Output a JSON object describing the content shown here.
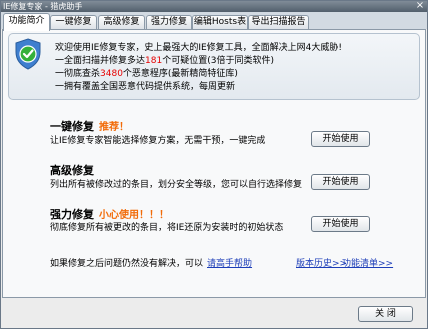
{
  "window": {
    "title": "IE修复专家 - 猎虎助手",
    "close_icon": "close-icon",
    "close_glyph": "×"
  },
  "tabs": [
    {
      "label": "功能简介",
      "selected": true
    },
    {
      "label": "一键修复"
    },
    {
      "label": "高级修复"
    },
    {
      "label": "强力修复"
    },
    {
      "label": "编辑Hosts表"
    },
    {
      "label": "导出扫描报告"
    }
  ],
  "intro": {
    "icon": "shield-check-icon",
    "welcome": "欢迎使用IE修复专家，史上最强大的IE修复工具，全面解决上网4大威胁!",
    "scan": {
      "before": "一全面扫描并修复多达",
      "count": "181",
      "after": "个可疑位置(3倍于同类软件)"
    },
    "kill": {
      "before": "一彻底查杀",
      "count": "3480",
      "after": "个恶意程序(最新精简特征库)"
    },
    "update": "一拥有覆盖全国恶意代码提供系统，每周更新"
  },
  "options": [
    {
      "title": "一键修复",
      "tag": "推荐！",
      "description": "让IE修复专家智能选择修复方案，无需干预，一键完成",
      "button": "开始使用"
    },
    {
      "title": "高级修复",
      "description": "列出所有被修改过的条目，划分安全等级，您可以自行选择修复",
      "button": "开始使用"
    },
    {
      "title": "强力修复",
      "tag": "小心使用！！！",
      "description": "彻底修复所有被更改的条目，将IE还原为安装时的初始状态",
      "button": "开始使用"
    }
  ],
  "help": {
    "text": "如果修复之后问题仍然没有解决，可以",
    "link": "请高手帮助",
    "version_history": "版本历史>>",
    "feature_list": "功能清单>>"
  },
  "footer": {
    "close_button": "关 闭"
  },
  "colors": {
    "title_bar": "#5d6c7b",
    "tag": "#f26b08",
    "highlight": "#e60000",
    "link": "#1c3db8"
  }
}
